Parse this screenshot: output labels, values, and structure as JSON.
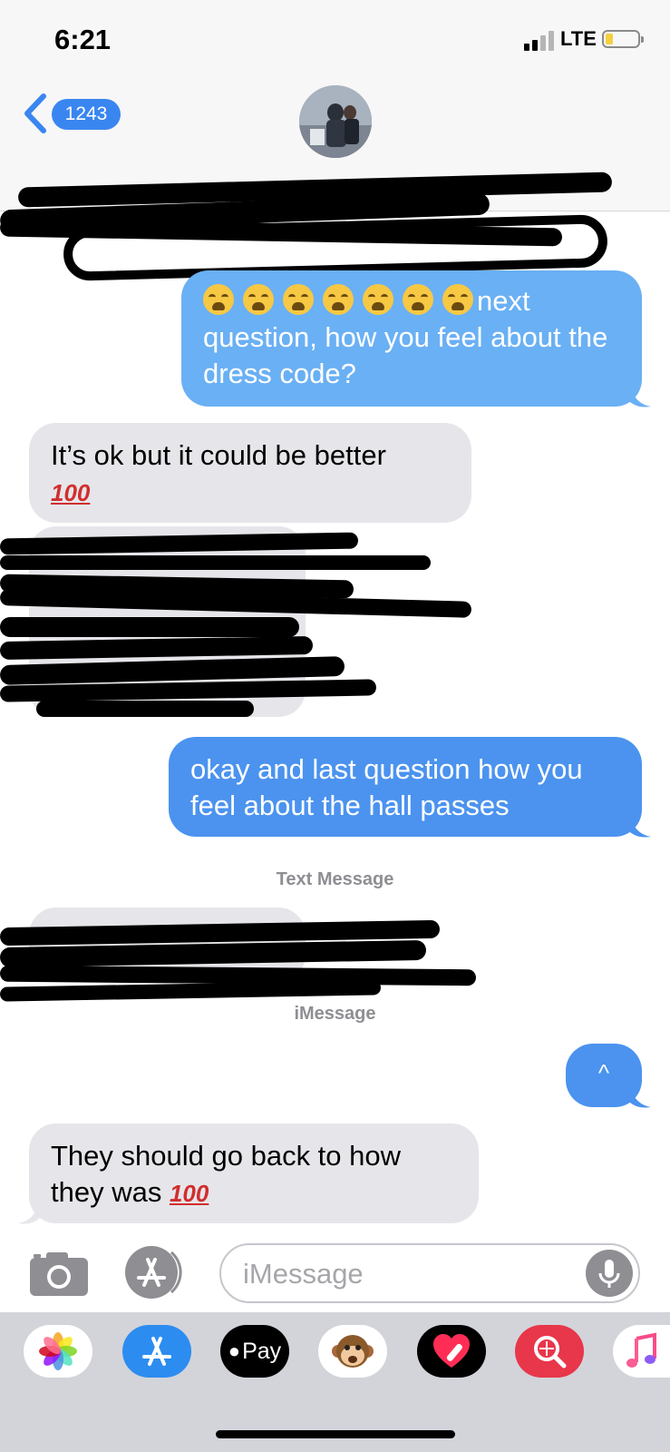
{
  "status_bar": {
    "time": "6:21",
    "carrier": "LTE"
  },
  "header": {
    "back_count": "1243"
  },
  "messages": {
    "sent_1_text": "next question, how you feel about the dress code?",
    "recv_1_text": "It’s ok but it could be better",
    "recv_1_emoji": "100",
    "sent_2_text": "okay and last question how you feel about the hall passes",
    "timestamp_1": "Text Message",
    "timestamp_2": "iMessage",
    "sent_3_text": "^",
    "recv_3_text": "They should go back to how they was",
    "recv_3_emoji": "100"
  },
  "input": {
    "placeholder": "iMessage"
  },
  "app_drawer": {
    "apple_pay_label": "Pay",
    "icons": [
      "photos-icon",
      "app-store-icon",
      "apple-pay-icon",
      "animoji-icon",
      "digital-touch-icon",
      "search-images-icon",
      "music-icon"
    ]
  },
  "colors": {
    "sent_bubble": "#4b93ef",
    "received_bubble": "#e6e6ea",
    "accent": "#3a86f0"
  }
}
